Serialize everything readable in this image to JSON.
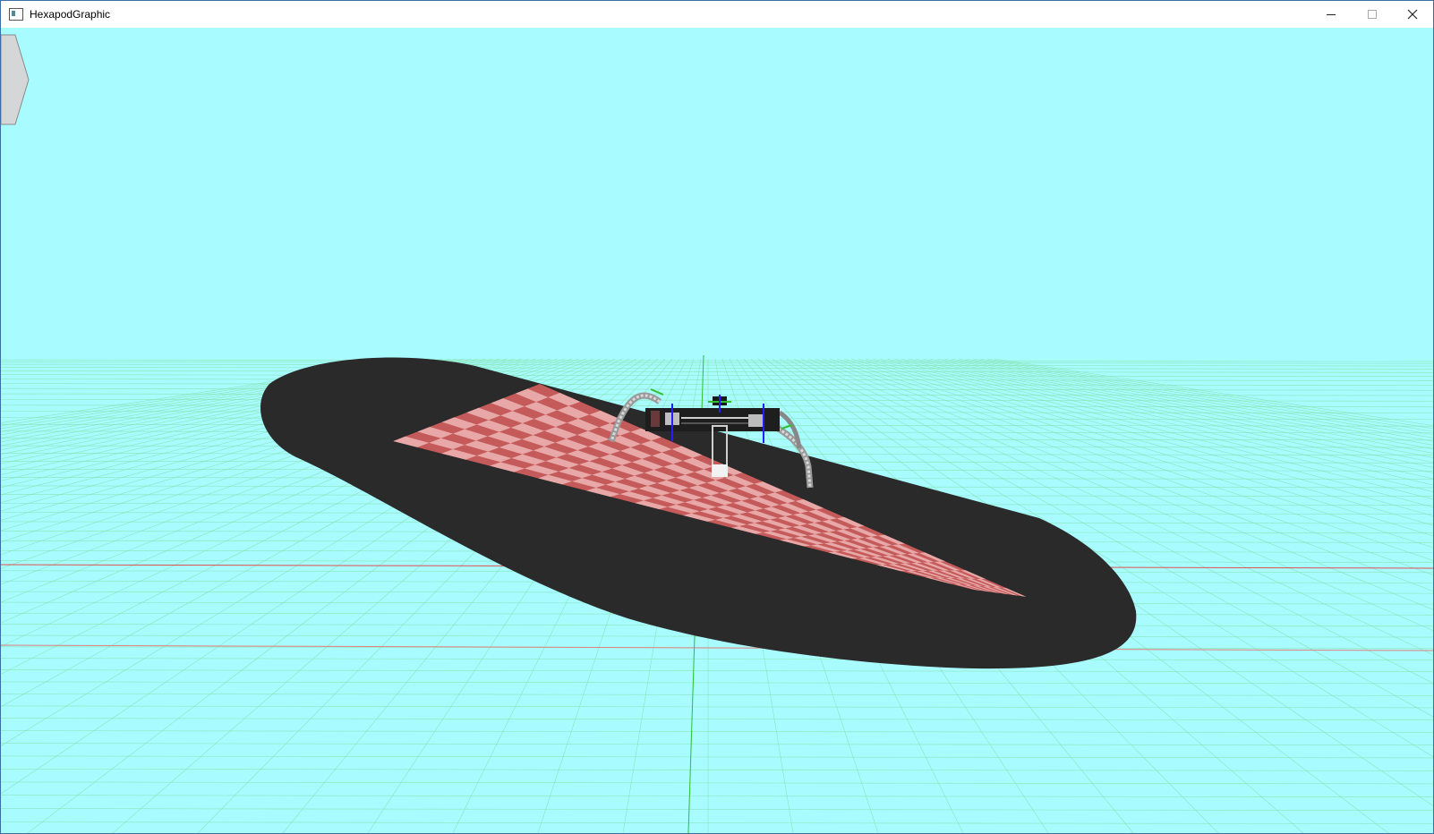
{
  "window": {
    "title": "HexapodGraphic",
    "app_icon": "app-window-icon",
    "controls": {
      "minimize": "minimize-icon",
      "maximize": "maximize-icon",
      "close": "close-icon"
    }
  },
  "viewport": {
    "background_color": "#a8fbff",
    "floor_color": "#2a2a2a",
    "checker_dark": "#c45a5a",
    "checker_light": "#e8a8a8",
    "grid_color": "#7fdc9a",
    "axis_x_color": "#e05050",
    "axis_z_color": "#30c030",
    "panel_toggle_icon": "chevron-right-icon"
  }
}
